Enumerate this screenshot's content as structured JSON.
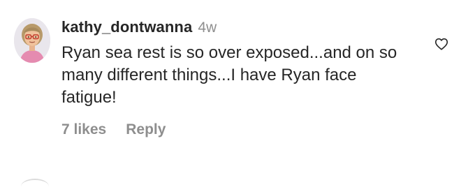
{
  "comment": {
    "username": "kathy_dontwanna",
    "time_ago": "4w",
    "text": "Ryan sea rest is so over exposed...and on so many different things...I have Ryan face fatigue!",
    "likes_label": "7 likes",
    "reply_label": "Reply",
    "like_icon": "heart-outline-icon",
    "avatar": "bitmoji-avatar"
  },
  "colors": {
    "primary_text": "#262626",
    "secondary_text": "#8e8e8e",
    "background": "#ffffff"
  }
}
